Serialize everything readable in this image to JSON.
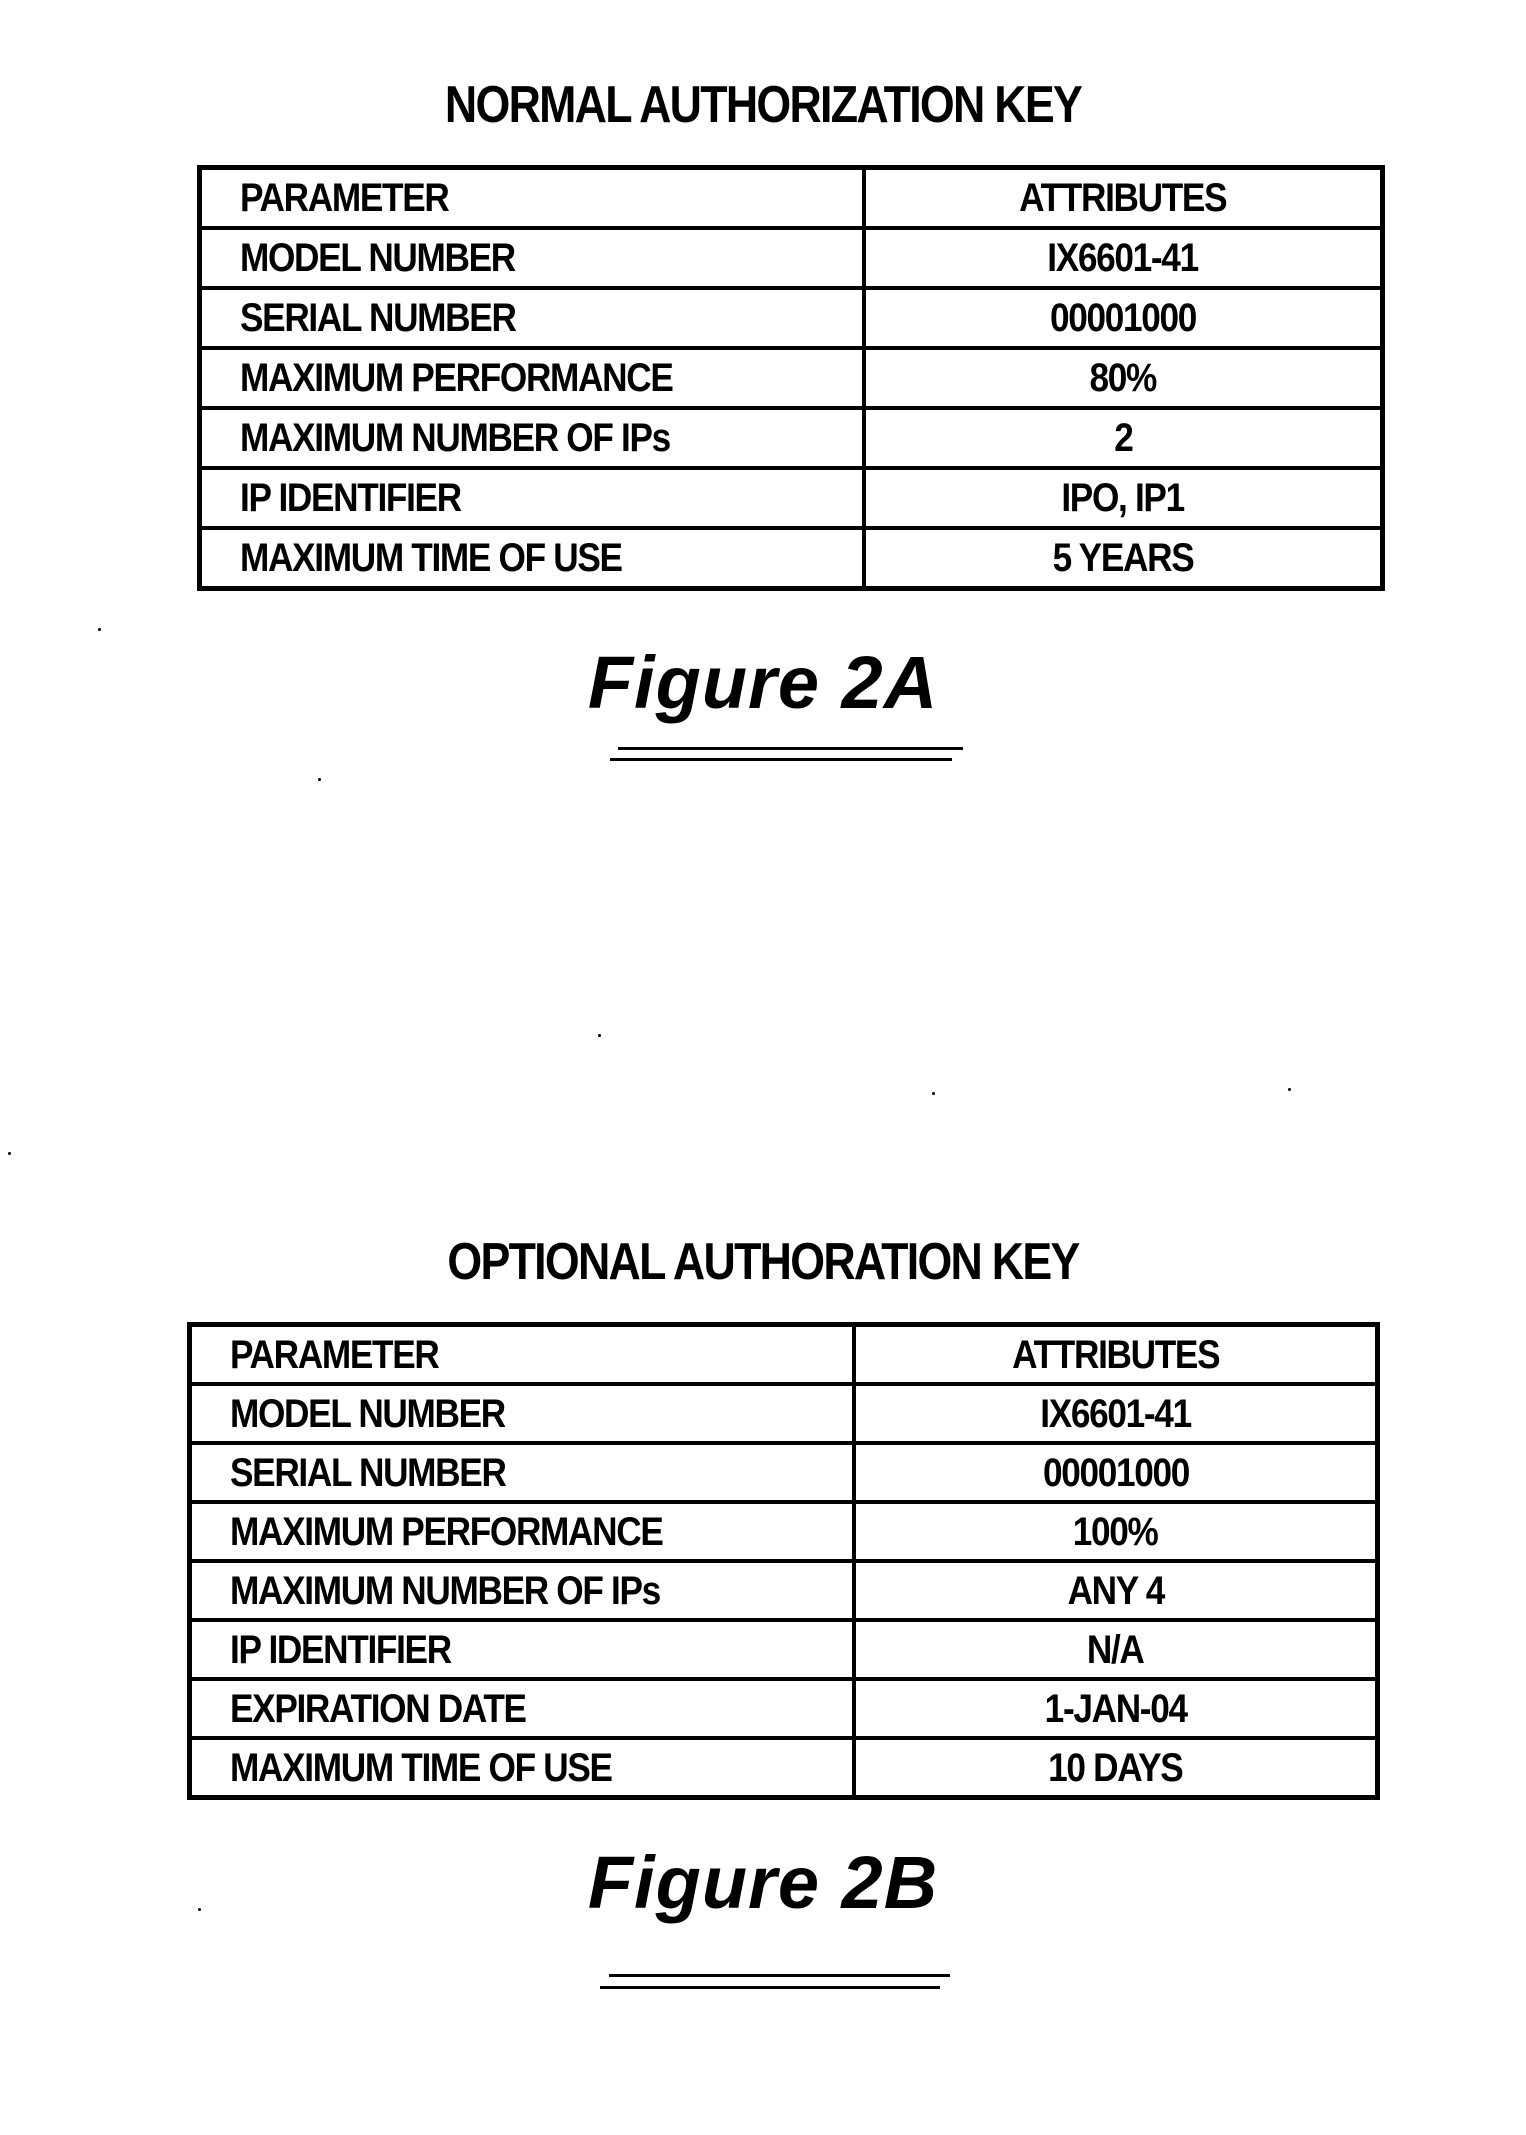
{
  "figures": [
    {
      "title": "NORMAL AUTHORIZATION KEY",
      "header": {
        "parameter": "PARAMETER",
        "attributes": "ATTRIBUTES"
      },
      "rows": [
        {
          "parameter": "MODEL NUMBER",
          "attribute": "IX6601-41"
        },
        {
          "parameter": "SERIAL NUMBER",
          "attribute": "00001000"
        },
        {
          "parameter": "MAXIMUM PERFORMANCE",
          "attribute": "80%"
        },
        {
          "parameter": "MAXIMUM NUMBER OF IPs",
          "attribute": "2"
        },
        {
          "parameter": "IP IDENTIFIER",
          "attribute": "IPO, IP1"
        },
        {
          "parameter": "MAXIMUM TIME OF USE",
          "attribute": "5 YEARS"
        }
      ],
      "label": "Figure 2A"
    },
    {
      "title": "OPTIONAL AUTHORATION KEY",
      "header": {
        "parameter": "PARAMETER",
        "attributes": "ATTRIBUTES"
      },
      "rows": [
        {
          "parameter": "MODEL NUMBER",
          "attribute": "IX6601-41"
        },
        {
          "parameter": "SERIAL NUMBER",
          "attribute": "00001000"
        },
        {
          "parameter": "MAXIMUM PERFORMANCE",
          "attribute": "100%"
        },
        {
          "parameter": "MAXIMUM NUMBER OF IPs",
          "attribute": "ANY 4"
        },
        {
          "parameter": "IP IDENTIFIER",
          "attribute": "N/A"
        },
        {
          "parameter": "EXPIRATION DATE",
          "attribute": "1-JAN-04"
        },
        {
          "parameter": "MAXIMUM TIME OF USE",
          "attribute": "10 DAYS"
        }
      ],
      "label": "Figure 2B"
    }
  ]
}
